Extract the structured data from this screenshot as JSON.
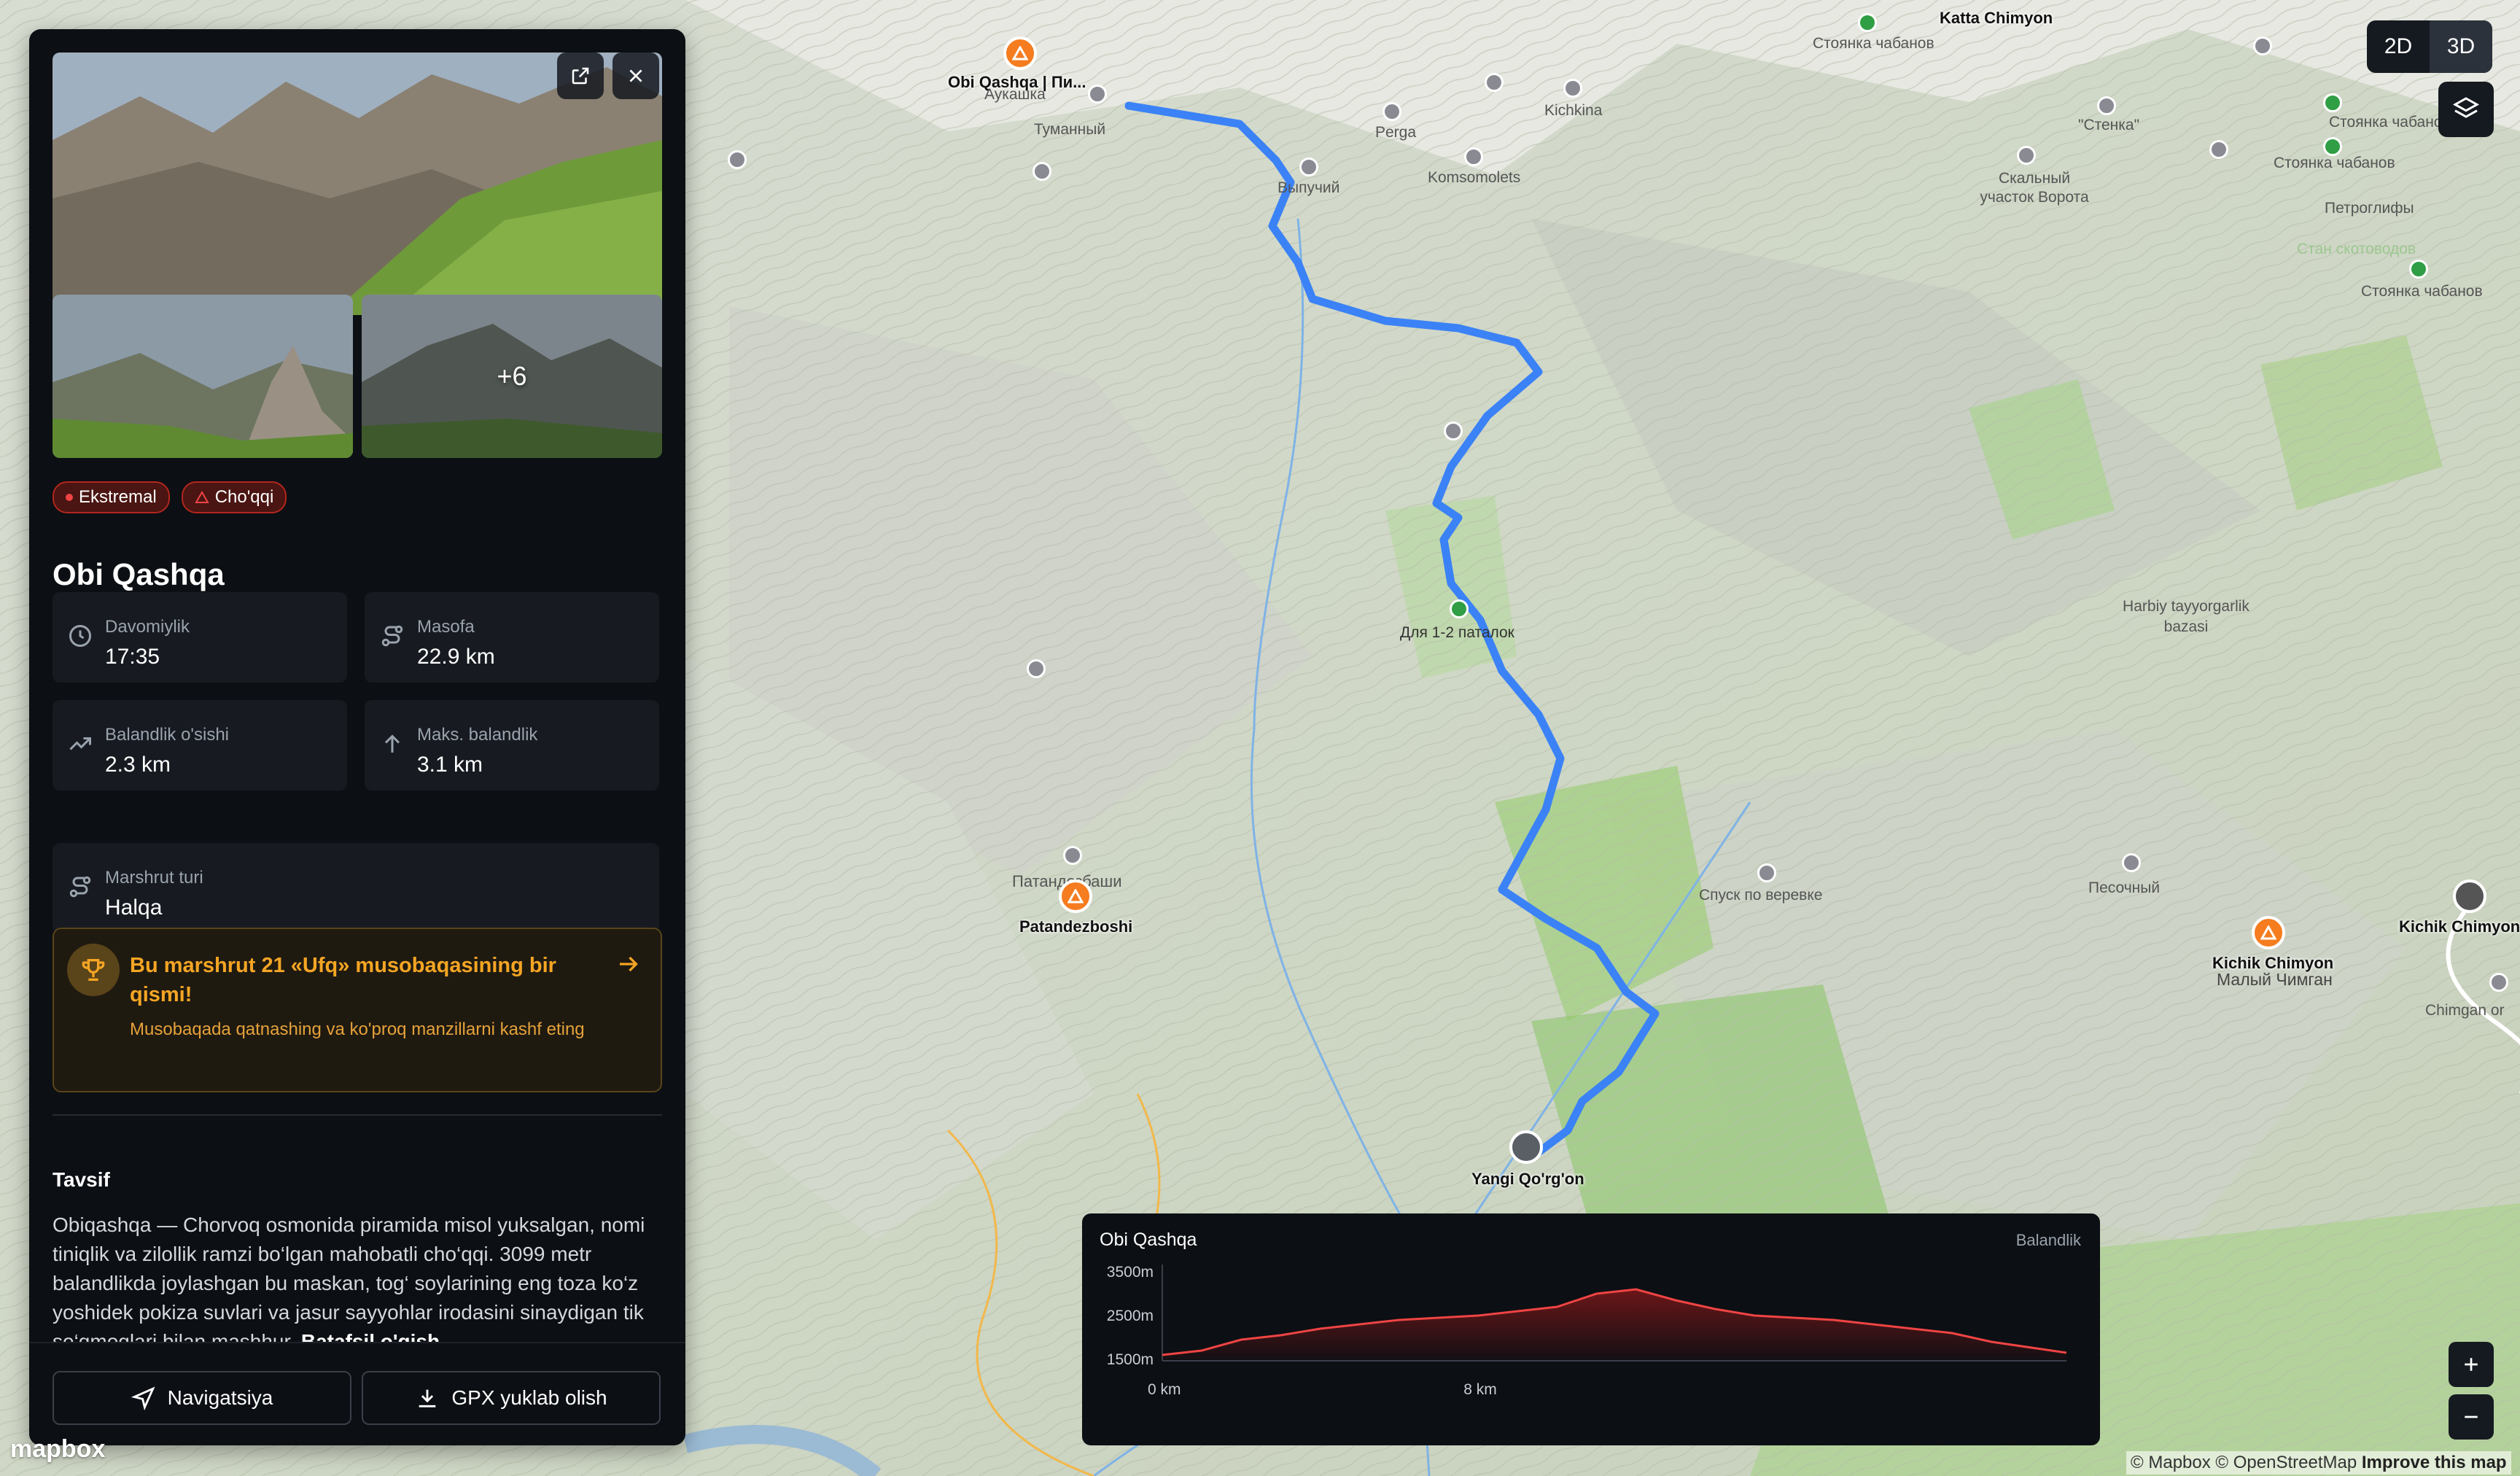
{
  "panel": {
    "more_photos": "+6",
    "badges": {
      "difficulty": "Ekstremal",
      "category": "Cho'qqi"
    },
    "title": "Obi Qashqa",
    "stats": [
      {
        "label": "Davomiylik",
        "value": "17:35",
        "icon": "clock-icon"
      },
      {
        "label": "Masofa",
        "value": "22.9 km",
        "icon": "route-icon"
      },
      {
        "label": "Balandlik o'sishi",
        "value": "2.3 km",
        "icon": "trending-up-icon"
      },
      {
        "label": "Maks. balandlik",
        "value": "3.1 km",
        "icon": "arrow-up-icon"
      },
      {
        "label": "Marshrut turi",
        "value": "Halqa",
        "icon": "route-icon"
      }
    ],
    "promo": {
      "title": "Bu marshrut 21 «Ufq» musobaqasining bir qismi!",
      "subtitle": "Musobaqada qatnashing va ko'proq manzillarni kashf eting"
    },
    "description_heading": "Tavsif",
    "description": "Obiqashqa — Chorvoq osmonida piramida misol yuksalgan, nomi tiniqlik va zilollik ramzi bo‘lgan mahobatli cho‘qqi. 3099 metr balandlikda joylashgan bu maskan, tog‘ soylarining eng toza ko‘z yoshidek pokiza suvlari va jasur sayyohlar irodasini sinaydigan tik so‘qmoqlari bilan mashhur.",
    "read_more": "Batafsil o'qish",
    "buttons": {
      "navigation": "Navigatsiya",
      "gpx": "GPX yuklab olish"
    }
  },
  "view_toggle": {
    "two_d": "2D",
    "three_d": "3D",
    "active": "3D"
  },
  "map_labels": {
    "obi_qashqa": "Obi Qashqa | Пи...",
    "aukashka": "Аукашка",
    "tumanny": "Туманный",
    "perga": "Perga",
    "kichkina": "Kichkina",
    "komsomolets": "Komsomolets",
    "vypuchy": "Выпучий",
    "katta_chimyon": "Katta Chimyon",
    "stoyanka1": "Стоянка чабанов",
    "stoyanka2": "Стоянка чабанов",
    "stoyanka3": "Стоянка чабанов",
    "stoyanka4": "Стоянка чабанов",
    "stenka": "\"Стенка\"",
    "skalny": "Скальный участок Ворота",
    "petroglify": "Петроглифы",
    "stan_skotovodov": "Стан скотоводов",
    "dlya": "Для 1-2 паталок",
    "harbiy": "Harbiy tayyorgarlik bazasi",
    "spusk": "Спуск по веревке",
    "pesochny": "Песочный",
    "patandezboshi_ru": "Патандезбаши",
    "patandezboshi": "Patandezboshi",
    "yangi_qorgon": "Yangi Qo'rg'on",
    "kichik_chimyon": "Kichik Chimyon",
    "kichik_chimyon2": "Kichik Chimyon",
    "maly_chimgan": "Малый Чимган",
    "chimgan_or": "Chimgan or"
  },
  "elevation": {
    "title": "Obi Qashqa",
    "label": "Balandlik",
    "chart_data": {
      "type": "area",
      "x_ticks": [
        "0 km",
        "8 km"
      ],
      "y_ticks": [
        "3500m",
        "2500m",
        "1500m"
      ],
      "ylim": [
        1500,
        3500
      ],
      "x": [
        0,
        1,
        2,
        3,
        4,
        5,
        6,
        7,
        8,
        9,
        10,
        11,
        12,
        13,
        14,
        15,
        16,
        17,
        18,
        19,
        20,
        21,
        22.9
      ],
      "values": [
        1600,
        1700,
        1950,
        2050,
        2200,
        2300,
        2400,
        2450,
        2500,
        2600,
        2700,
        3000,
        3100,
        2850,
        2650,
        2500,
        2450,
        2400,
        2300,
        2200,
        2100,
        1900,
        1650
      ]
    }
  },
  "attribution": {
    "mapbox": "© Mapbox",
    "osm": "© OpenStreetMap",
    "improve": "Improve this map"
  },
  "logo": "mapbox",
  "colors": {
    "route": "#3b82f6",
    "peak": "#f57c1f",
    "accent": "#f5a524",
    "danger": "#ef4444"
  }
}
